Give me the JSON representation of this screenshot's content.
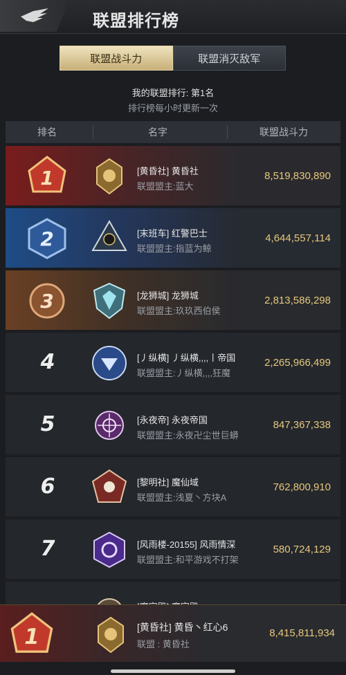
{
  "header": {
    "title": "联盟排行榜",
    "back_icon": "wing-back-icon"
  },
  "tabs": [
    {
      "label": "联盟战斗力",
      "active": true
    },
    {
      "label": "联盟消灭敌军",
      "active": false
    }
  ],
  "info": {
    "my_rank": "我的联盟排行: 第1名",
    "update_note": "排行榜每小时更新一次"
  },
  "columns": [
    "排名",
    "名字",
    "联盟战斗力"
  ],
  "rows": [
    {
      "rank": "1",
      "name": "[黄昏社] 黄昏社",
      "leader": "联盟盟主:蓝大",
      "power": "8,519,830,890",
      "badge": "gold-eagle-emblem-icon"
    },
    {
      "rank": "2",
      "name": "[末班车] 红警巴士",
      "leader": "联盟盟主:指蓝为鲸",
      "power": "4,644,557,114",
      "badge": "skull-star-emblem-icon"
    },
    {
      "rank": "3",
      "name": "[龙狮城] 龙狮城",
      "leader": "联盟盟主:玖玖西伯侯",
      "power": "2,813,586,298",
      "badge": "ice-shield-emblem-icon"
    },
    {
      "rank": "4",
      "name": "[丿纵横] 丿纵横,,,,丨帝国",
      "leader": "联盟盟主:丿纵横,,,,狂魔",
      "power": "2,265,966,499",
      "badge": "blue-wing-emblem-icon"
    },
    {
      "rank": "5",
      "name": "[永夜帝] 永夜帝国",
      "leader": "联盟盟主:永夜卍尘世巨蟒",
      "power": "847,367,338",
      "badge": "crosshair-emblem-icon"
    },
    {
      "rank": "6",
      "name": "[黎明社] 魔仙域",
      "leader": "联盟盟主:浅夏丶方块A",
      "power": "762,800,910",
      "badge": "skull-crossbones-emblem-icon"
    },
    {
      "rank": "7",
      "name": "[风雨楼-20155] 风雨情深",
      "leader": "联盟盟主:和平游戏不打架",
      "power": "580,724,129",
      "badge": "purple-swirl-emblem-icon"
    },
    {
      "rank": "",
      "name": "[魔宗殿] 魔宗殿",
      "leader": "",
      "power": "",
      "badge": "partial-emblem-icon"
    }
  ],
  "my_alliance": {
    "rank": "1",
    "name": "[黄昏社] 黄昏丶红心6",
    "leader": "联盟 : 黄昏社",
    "power": "8,415,811,934",
    "badge": "gold-eagle-emblem-icon"
  },
  "colors": {
    "accent_gold": "#e7c87c",
    "rank1": "#7a1c1c",
    "rank2": "#1e4c86",
    "rank3": "#6a4024"
  }
}
